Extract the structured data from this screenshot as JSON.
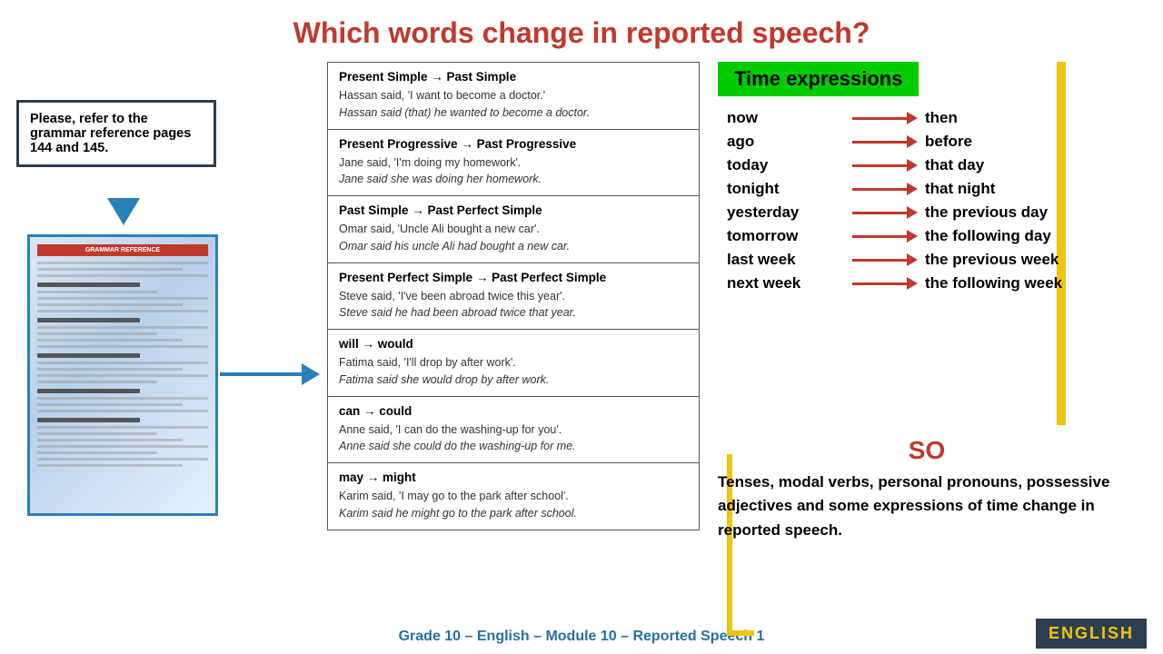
{
  "title": "Which words change in reported speech?",
  "left_box": {
    "text": "Please, refer to the grammar reference pages 144 and 145."
  },
  "grammar_sections": [
    {
      "id": "present-simple",
      "title": "Present Simple → Past Simple",
      "lines": [
        "Hassan said, 'I want to become a doctor.'",
        "Hassan said (that) he wanted to become a doctor."
      ]
    },
    {
      "id": "present-progressive",
      "title": "Present Progressive → Past Progressive",
      "lines": [
        "Jane said, 'I'm doing my homework'.",
        "Jane said she was doing her homework."
      ]
    },
    {
      "id": "past-simple",
      "title": "Past Simple → Past Perfect Simple",
      "lines": [
        "Omar said, 'Uncle Ali bought a new car'.",
        "Omar said his uncle Ali had bought a new car."
      ]
    },
    {
      "id": "present-perfect",
      "title": "Present Perfect Simple → Past Perfect Simple",
      "lines": [
        "Steve said, 'I've been abroad twice this year'.",
        "Steve said he had been abroad twice that year."
      ]
    },
    {
      "id": "will-would",
      "title": "will → would",
      "lines": [
        "Fatima said, 'I'll drop by after work'.",
        "Fatima said she would drop by after work."
      ]
    },
    {
      "id": "can-could",
      "title": "can → could",
      "lines": [
        "Anne said, 'I can do the washing-up for you'.",
        "Anne said she could do the washing-up for me."
      ]
    },
    {
      "id": "may-might",
      "title": "may → might",
      "lines": [
        "Karim said, 'I may go to the park after school'.",
        "Karim said he might go to the park after school."
      ]
    }
  ],
  "time_expressions": {
    "header": "Time expressions",
    "pairs": [
      {
        "left": "now",
        "right": "then"
      },
      {
        "left": "ago",
        "right": "before"
      },
      {
        "left": "today",
        "right": "that day"
      },
      {
        "left": "tonight",
        "right": "that night"
      },
      {
        "left": "yesterday",
        "right": "the previous day"
      },
      {
        "left": "tomorrow",
        "right": "the following day"
      },
      {
        "left": "last week",
        "right": "the previous week"
      },
      {
        "left": "next week",
        "right": "the following week"
      }
    ]
  },
  "so_label": "SO",
  "so_text": "Tenses, modal verbs, personal pronouns, possessive adjectives and some expressions of time change in reported speech.",
  "footer": "Grade 10 – English – Module 10 – Reported Speech 1",
  "english_logo": "ENGLISH"
}
